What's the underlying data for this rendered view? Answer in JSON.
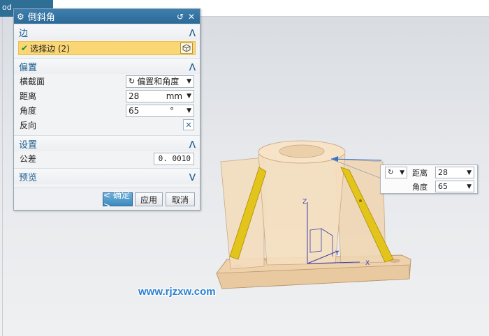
{
  "app": {
    "tab_title": "od"
  },
  "dialog": {
    "title": "倒斜角",
    "edge_section": {
      "title": "边",
      "select_label": "选择边 (2)"
    },
    "offset_section": {
      "title": "偏置",
      "cross_section_label": "横截面",
      "cross_section_value": "偏置和角度",
      "distance_label": "距离",
      "distance_value": "28",
      "distance_unit": "mm",
      "angle_label": "角度",
      "angle_value": "65",
      "angle_unit": "°",
      "reverse_label": "反向"
    },
    "settings_section": {
      "title": "设置",
      "tolerance_label": "公差",
      "tolerance_value": "0. 0010"
    },
    "preview_section": {
      "title": "预览"
    },
    "buttons": {
      "ok": "< 确定 >",
      "apply": "应用",
      "cancel": "取消"
    }
  },
  "float_panel": {
    "distance_label": "距离",
    "distance_value": "28",
    "angle_label": "角度",
    "angle_value": "65"
  },
  "axes": {
    "z": "Z",
    "y": "Y",
    "x": "X"
  },
  "watermark": "www.rjzxw.com",
  "colors": {
    "title_bar": "#2c6a97",
    "accent_text": "#1f5f8f",
    "selection_bg": "#fad774",
    "model_body": "#f2d9b4",
    "chamfer_face": "#e2c41a",
    "watermark": "#2a7fd0"
  }
}
